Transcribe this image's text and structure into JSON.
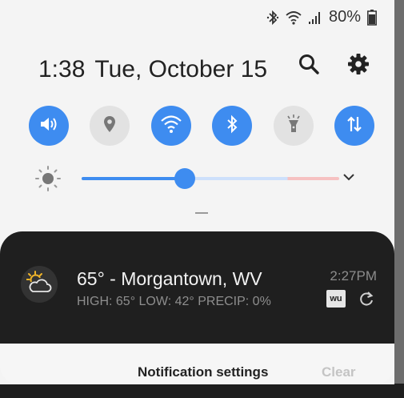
{
  "status_bar": {
    "battery_percent": "80%",
    "icons": [
      "bluetooth-icon",
      "wifi-icon",
      "signal-icon",
      "battery-icon"
    ]
  },
  "header": {
    "time": "1:38",
    "date": "Tue, October 15",
    "icons": [
      "search-icon",
      "settings-gear-icon"
    ]
  },
  "quick_toggles": [
    {
      "name": "sound",
      "icon": "volume-icon",
      "on": true
    },
    {
      "name": "location",
      "icon": "location-pin-icon",
      "on": false
    },
    {
      "name": "wifi",
      "icon": "wifi-icon",
      "on": true
    },
    {
      "name": "bluetooth",
      "icon": "bluetooth-icon",
      "on": true
    },
    {
      "name": "flashlight",
      "icon": "flashlight-icon",
      "on": false
    },
    {
      "name": "mobile-data",
      "icon": "data-arrows-icon",
      "on": true
    }
  ],
  "brightness": {
    "level": 0.4,
    "icon": "sun-icon"
  },
  "notification": {
    "title": "65° - Morgantown, WV",
    "subtitle": "HIGH: 65° LOW: 42° PRECIP: 0%",
    "time": "2:27PM",
    "app_badge": "wu",
    "icon": "partly-cloudy-icon"
  },
  "actions": {
    "settings_label": "Notification settings",
    "clear_label": "Clear"
  },
  "colors": {
    "accent": "#3e8cf0",
    "panel_bg": "#f4f4f4",
    "notification_bg": "#1f1f1f"
  }
}
